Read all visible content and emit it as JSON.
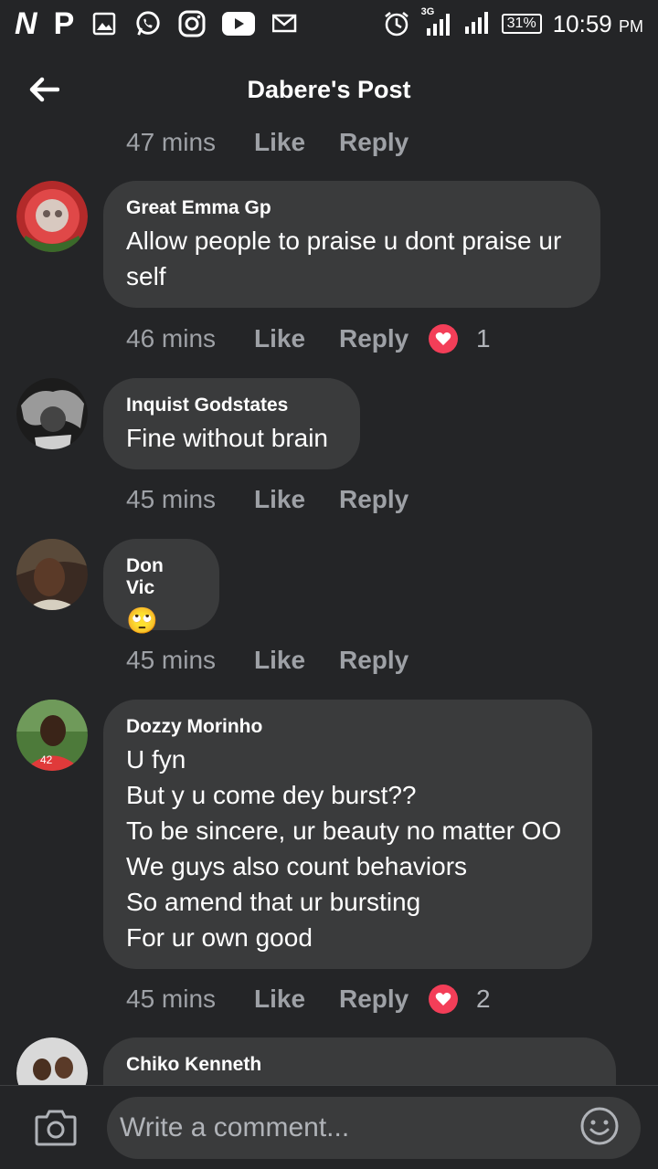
{
  "status_bar": {
    "left_glyphs": [
      "N",
      "P"
    ],
    "icons": [
      "gallery-icon",
      "whatsapp-icon",
      "instagram-icon",
      "youtube-icon",
      "mail-icon"
    ],
    "right_icons": [
      "alarm-icon",
      "signal-3g-icon",
      "signal-icon"
    ],
    "network_label": "3G",
    "battery": "31%",
    "time": "10:59",
    "ampm": "PM"
  },
  "header": {
    "title": "Dabere's Post",
    "back_icon": "back-arrow-icon"
  },
  "top_actions": {
    "time": "47 mins",
    "like": "Like",
    "reply": "Reply"
  },
  "comments": [
    {
      "author": "Great Emma Gp",
      "text": "Allow people to praise u dont praise ur self",
      "time": "46 mins",
      "like": "Like",
      "reply": "Reply",
      "reaction_count": "1",
      "reaction_icon": "heart-icon"
    },
    {
      "author": "Inquist Godstates",
      "text": "Fine without brain",
      "time": "45 mins",
      "like": "Like",
      "reply": "Reply"
    },
    {
      "author": "Don Vic",
      "text": "🙄",
      "time": "45 mins",
      "like": "Like",
      "reply": "Reply"
    },
    {
      "author": "Dozzy Morinho",
      "text": "U fyn\nBut y u come dey burst??\nTo be sincere, ur beauty no matter OO\nWe guys also count behaviors\nSo amend that ur bursting\nFor ur own good",
      "time": "45 mins",
      "like": "Like",
      "reply": "Reply",
      "reaction_count": "2",
      "reaction_icon": "heart-icon"
    },
    {
      "author": "Chiko Kenneth",
      "text": ""
    }
  ],
  "composer": {
    "placeholder": "Write a comment...",
    "camera_icon": "camera-icon",
    "emoji_icon": "emoji-icon"
  },
  "colors": {
    "background": "#242527",
    "bubble": "#3a3b3c",
    "secondary_text": "#9ea1a6",
    "heart": "#f33e58"
  }
}
